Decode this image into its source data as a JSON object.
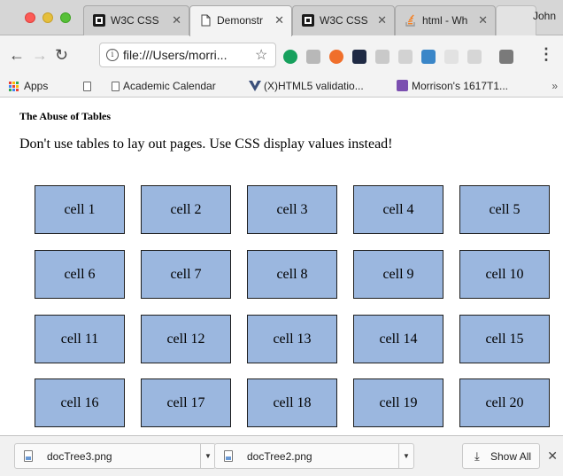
{
  "tabs": [
    {
      "title": "W3C CSS",
      "icon": "w3c-icon",
      "active": false
    },
    {
      "title": "Demonstr",
      "icon": "document-icon",
      "active": true
    },
    {
      "title": "W3C CSS",
      "icon": "w3c-icon",
      "active": false
    },
    {
      "title": "html - Wh",
      "icon": "stack-overflow-icon",
      "active": false
    }
  ],
  "profile_name": "John",
  "toolbar": {
    "url": "file:///Users/morri..."
  },
  "bookmarks": {
    "apps_label": "Apps",
    "items": [
      {
        "label": ""
      },
      {
        "label": "Academic Calendar"
      },
      {
        "label": "(X)HTML5 validatio..."
      },
      {
        "label": "Morrison's 1617T1..."
      }
    ],
    "overflow": "»"
  },
  "page": {
    "heading": "The Abuse of Tables",
    "paragraph": "Don't use tables to lay out pages. Use CSS display values instead!",
    "cell_color": "#9bb7df",
    "cells": [
      "cell 1",
      "cell 2",
      "cell 3",
      "cell 4",
      "cell 5",
      "cell 6",
      "cell 7",
      "cell 8",
      "cell 9",
      "cell 10",
      "cell 11",
      "cell 12",
      "cell 13",
      "cell 14",
      "cell 15",
      "cell 16",
      "cell 17",
      "cell 18",
      "cell 19",
      "cell 20"
    ]
  },
  "downloads": {
    "items": [
      {
        "filename": "docTree3.png"
      },
      {
        "filename": "docTree2.png"
      }
    ],
    "show_all_label": "Show All"
  }
}
